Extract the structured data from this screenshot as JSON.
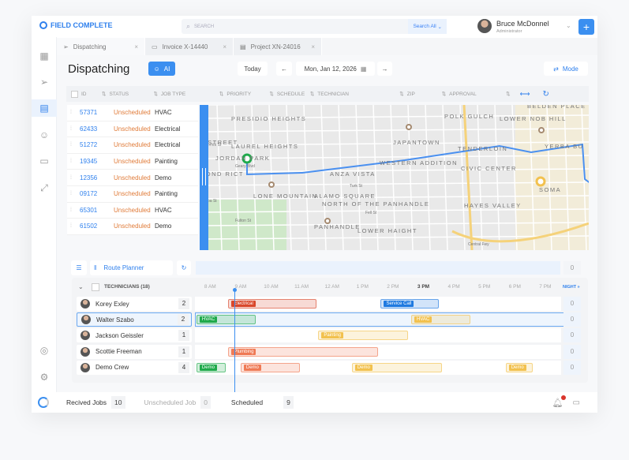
{
  "app": {
    "logo": "FIELD COMPLETE",
    "search_placeholder": "SEARCH",
    "search_scope": "Search All",
    "user_name": "Bruce McDonnel",
    "user_role": "Administrator"
  },
  "tabs": [
    {
      "label": "Dispatching"
    },
    {
      "label": "Invoice X-14440"
    },
    {
      "label": "Project XN-24016"
    }
  ],
  "header": {
    "title": "Dispatching",
    "ai_label": "AI",
    "today": "Today",
    "date": "Mon, Jan 12, 2026",
    "mode": "Mode"
  },
  "columns": [
    "ID",
    "STATUS",
    "JOB TYPE",
    "PRIORITY",
    "SCHEDULE",
    "TECHNICIAN",
    "ZIP",
    "APPROVAL"
  ],
  "jobs": [
    {
      "id": "57371",
      "status": "Unscheduled",
      "type": "HVAC"
    },
    {
      "id": "62433",
      "status": "Unscheduled",
      "type": "Electrical"
    },
    {
      "id": "51272",
      "status": "Unscheduled",
      "type": "Electrical"
    },
    {
      "id": "19345",
      "status": "Unscheduled",
      "type": "Painting"
    },
    {
      "id": "12356",
      "status": "Unscheduled",
      "type": "Demo"
    },
    {
      "id": "09172",
      "status": "Unscheduled",
      "type": "Painting"
    },
    {
      "id": "65301",
      "status": "Unscheduled",
      "type": "HVAC"
    },
    {
      "id": "61502",
      "status": "Unscheduled",
      "type": "Demo"
    }
  ],
  "map_labels": [
    "PRESIDIO HEIGHTS",
    "POLK GULCH",
    "LOWER NOB HILL",
    "BELDEN PLACE",
    "E STREET",
    "LAUREL HEIGHTS",
    "JAPANTOWN",
    "TENDERLOIN",
    "YERBA BU",
    "JORDAN PARK",
    "WESTERN ADDITION",
    "MOND RICT",
    "ANZA VISTA",
    "CIVIC CENTER",
    "SOMA",
    "LONE MOUNTAIN",
    "ALAMO SQUARE",
    "NORTH OF THE PANHANDLE",
    "HAYES VALLEY",
    "PANHANDLE",
    "LOWER HAIGHT",
    "California St",
    "Geary Blvd",
    "Turk St",
    "Balboa St",
    "Fulton St",
    "Fell St",
    "Central Fwy"
  ],
  "route_planner": {
    "label": "Route Planner",
    "unassigned_count": "0"
  },
  "gantt": {
    "header": "TECHNICIANS (18)",
    "hours": [
      "8 AM",
      "9 AM",
      "10 AM",
      "11 AM",
      "12 AM",
      "1 PM",
      "2 PM",
      "3 PM",
      "4 PM",
      "5 PM",
      "6 PM",
      "7 PM"
    ],
    "night": "NIGHT »",
    "current_time_hour": 9.3,
    "technicians": [
      {
        "name": "Korey Exley",
        "count": "2",
        "overflow": "0",
        "jobs": [
          {
            "label": "Electrical",
            "start": 9.1,
            "end": 12.0,
            "color": "#d9472b"
          },
          {
            "label": "Service Call",
            "start": 14.1,
            "end": 16.0,
            "color": "#1f7ae0"
          }
        ]
      },
      {
        "name": "Walter Szabo",
        "count": "2",
        "overflow": "0",
        "selected": true,
        "jobs": [
          {
            "label": "HVAC",
            "start": 8.05,
            "end": 10.0,
            "color": "#1faa4b"
          },
          {
            "label": "HVAC",
            "start": 15.1,
            "end": 17.05,
            "color": "#f2c14e"
          }
        ]
      },
      {
        "name": "Jackson Geissler",
        "count": "1",
        "overflow": "0",
        "jobs": [
          {
            "label": "Painting",
            "start": 12.05,
            "end": 15.0,
            "color": "#f2c14e"
          }
        ]
      },
      {
        "name": "Scottie Freeman",
        "count": "1",
        "overflow": "0",
        "jobs": [
          {
            "label": "Plumbing",
            "start": 9.1,
            "end": 14.0,
            "color": "#ef7a55"
          }
        ]
      },
      {
        "name": "Demo Crew",
        "count": "4",
        "overflow": "0",
        "jobs": [
          {
            "label": "Demo",
            "start": 8.05,
            "end": 9.0,
            "color": "#1faa4b"
          },
          {
            "label": "Demo",
            "start": 9.5,
            "end": 11.45,
            "color": "#ef7a55"
          },
          {
            "label": "Demo",
            "start": 13.15,
            "end": 16.1,
            "color": "#f2c14e"
          },
          {
            "label": "Demo",
            "start": 18.2,
            "end": 19.1,
            "color": "#f2c14e"
          }
        ]
      }
    ]
  },
  "footer": {
    "received_label": "Recived Jobs",
    "received": "10",
    "unscheduled_label": "Unscheduled Job",
    "unscheduled": "0",
    "scheduled_label": "Scheduled",
    "scheduled": "9"
  },
  "colors": {
    "accent": "#2f80ed",
    "unscheduled": "#e07b39"
  }
}
